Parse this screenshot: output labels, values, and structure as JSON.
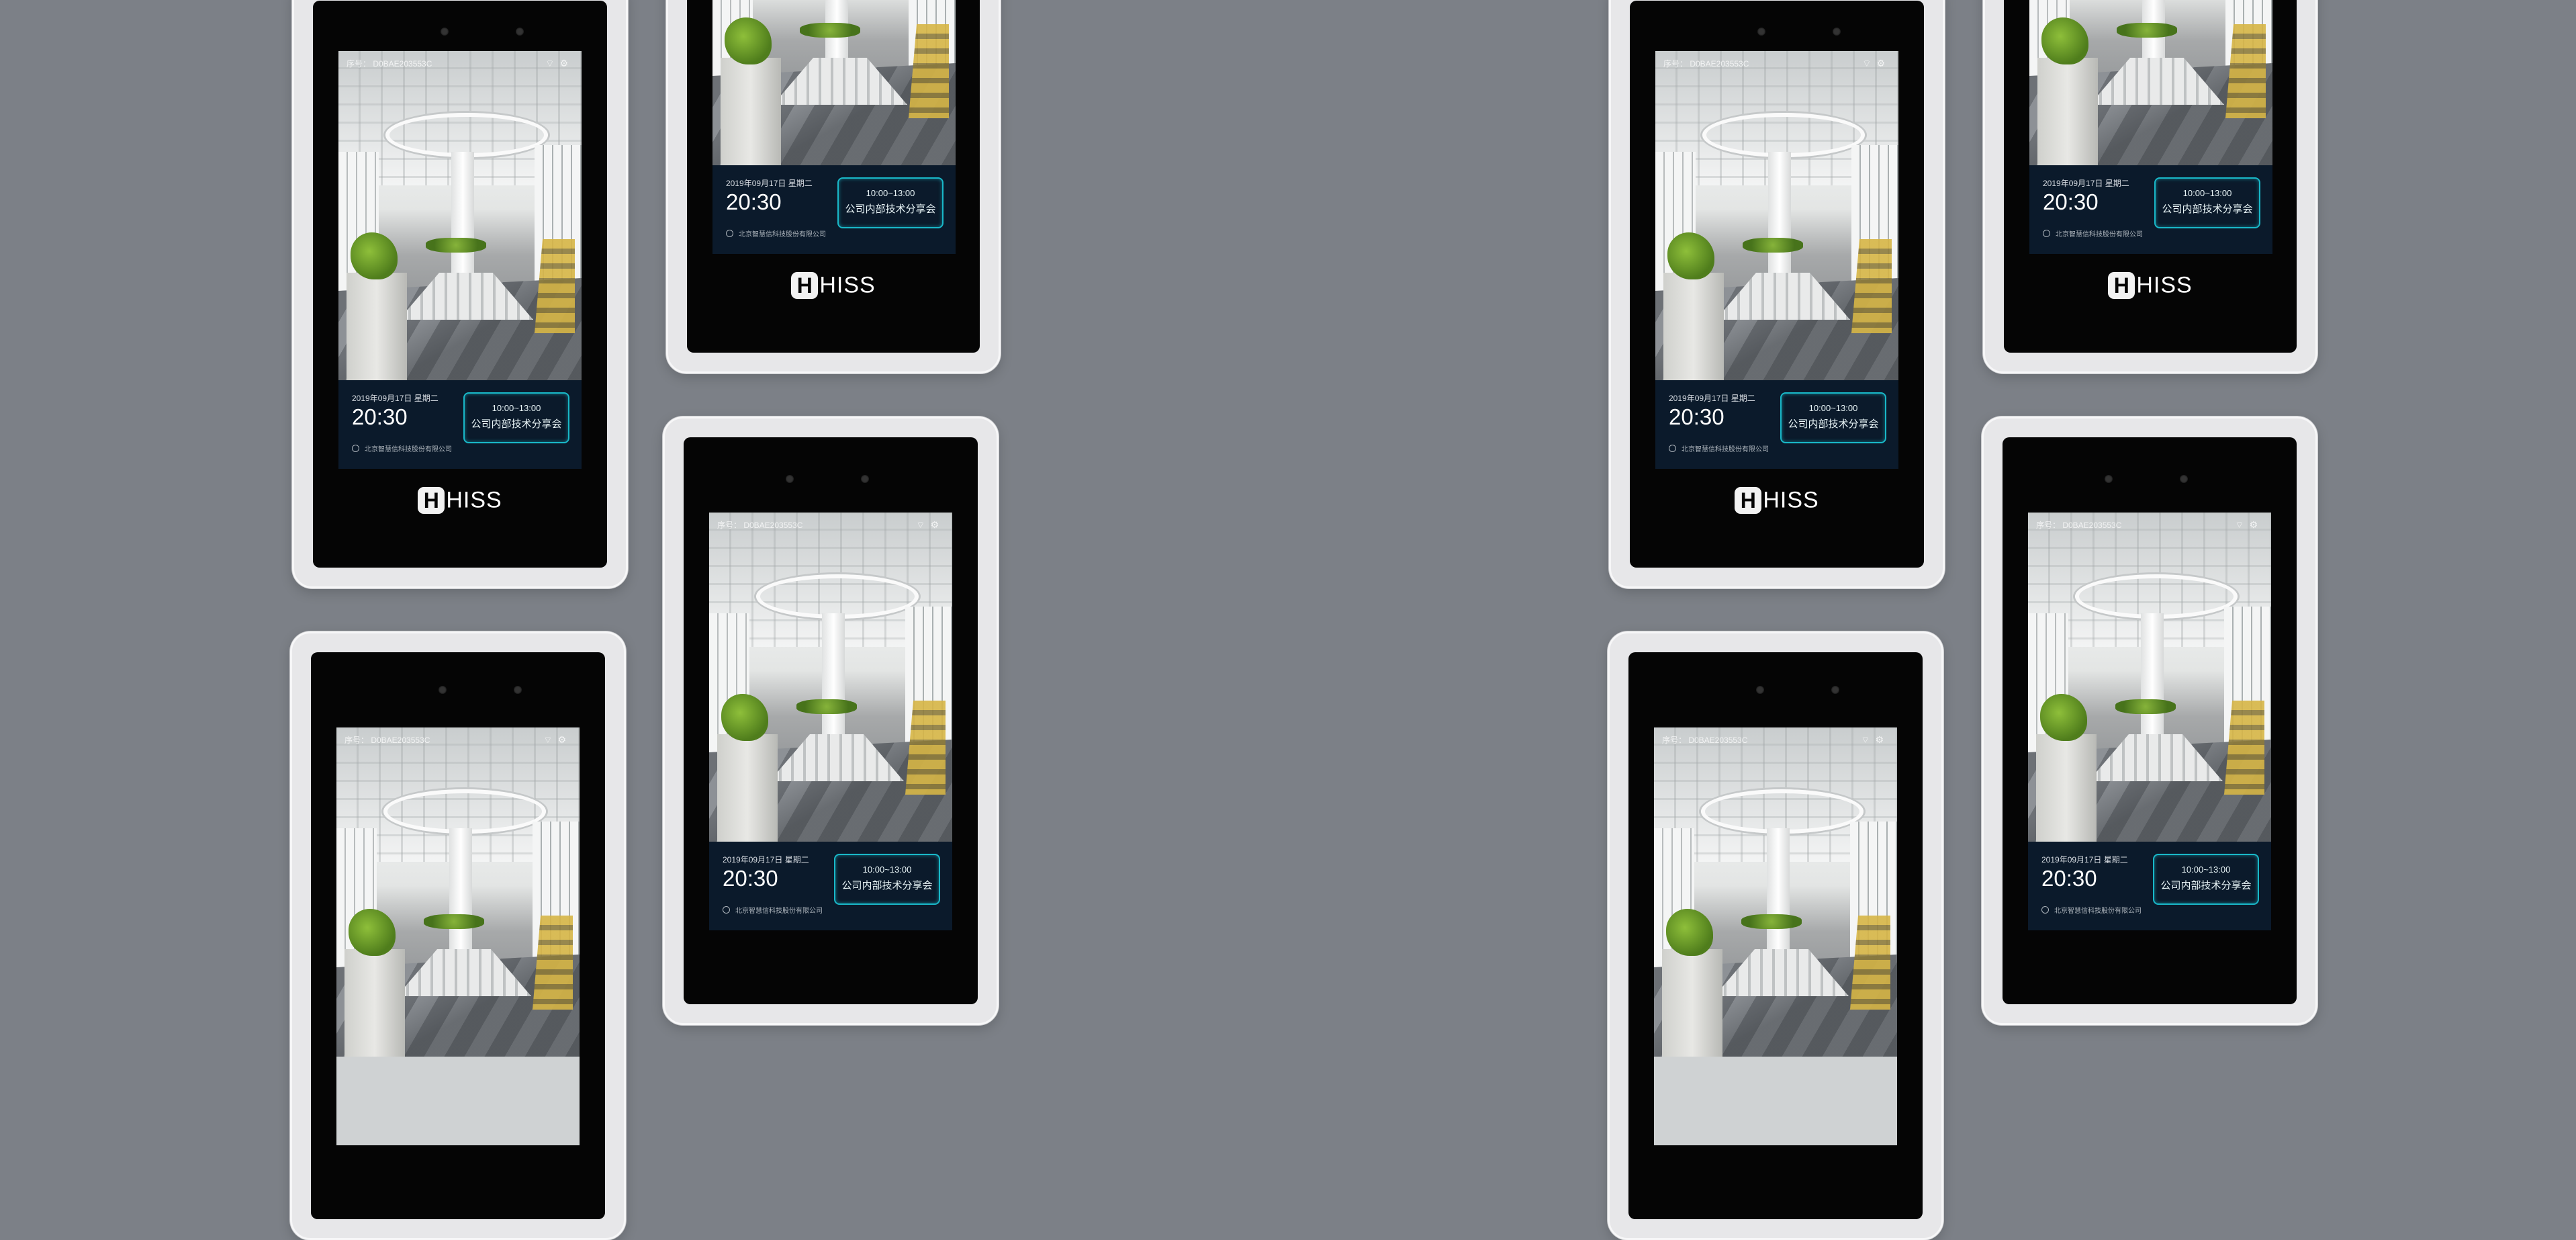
{
  "devices": [
    {
      "brand": "HISS",
      "screen": {
        "device_sn_label": "序号： D0BAE203553C",
        "status_icons": [
          "wifi-icon",
          "settings-icon"
        ],
        "date": "2019年09月17日 星期二",
        "time": "20:30",
        "company": "北京智慧信科技股份有限公司",
        "meeting": {
          "time": "10:00~13:00",
          "name": "公司内部技术分享会"
        }
      }
    }
  ],
  "colors": {
    "background": "#7c8087",
    "device_frame": "#e7e7e9",
    "bezel": "#050505",
    "info_panel": "#0b1a2b",
    "meeting_border": "#19b8c8"
  }
}
